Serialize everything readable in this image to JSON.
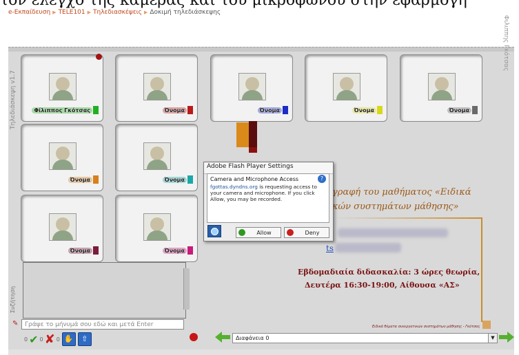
{
  "page": {
    "caption": "τον έλεγχο της κάμερας και του μικροφώνου στην εφαρμογή"
  },
  "breadcrumb": {
    "items": [
      "e-Εκπαίδευση",
      "TELE101",
      "Τηλεδιασκέψεις",
      "Δοκιμή τηλεδιάσκεψης"
    ]
  },
  "app": {
    "side_title": "Τηλεδιάσκεψη  v1.7",
    "author_vertical": "Φιλιππης Γκότσας"
  },
  "tiles": [
    {
      "name": "Φίλιππος Γκότσας",
      "color": "#22b022"
    },
    {
      "name": "Όνομα",
      "color": "#b81c1c"
    },
    {
      "name": "Όνομα",
      "color": "#1c2cc4"
    },
    {
      "name": "Όνομα",
      "color": "#d8d81c"
    },
    {
      "name": "Όνομα",
      "color": "#6a6a6a"
    },
    {
      "name": "Όνομα",
      "color": "#d8801c"
    },
    {
      "name": "Όνομα",
      "color": "#1ca8a8"
    },
    {
      "name": "Όνομα",
      "color": "#7a1c3c"
    },
    {
      "name": "Όνομα",
      "color": "#c81c7a"
    }
  ],
  "dialog": {
    "title": "Adobe Flash Player Settings",
    "heading": "Camera and Microphone Access",
    "site": "fgottas.dyndns.org",
    "message": " is requesting access to your camera and microphone. If you click Allow, you may be recorded.",
    "allow_label": "Allow",
    "deny_label": "Deny",
    "help_glyph": "?"
  },
  "content": {
    "course_line1": "γραφή του μαθήματος «Ειδικά",
    "course_line2": "κών συστημάτων μάθησης»",
    "email_prefix": "ts",
    "schedule_line1": "Εβδομαδιαία διδασκαλία: 3 ώρες θεωρία,",
    "schedule_line2": "Δευτέρα 16:30-19:00, Αίθουσα «ΑΣ»",
    "footer_note": "Ειδικά θέματα συνεργατικών συστημάτων μάθησης - Γκότσας"
  },
  "chat": {
    "label": "Συζήτηση",
    "placeholder": "Γράψε το μήνυμά σου εδώ και μετά Enter",
    "yes_count": "0",
    "no_count": "0",
    "hand_count": "0"
  },
  "navigation": {
    "slide_select_value": "Διαφάνεια 0"
  },
  "colors": {
    "stage_bg": "#d9d9d9",
    "accent_orange": "#c98c2a",
    "dark_red": "#7a1313"
  }
}
